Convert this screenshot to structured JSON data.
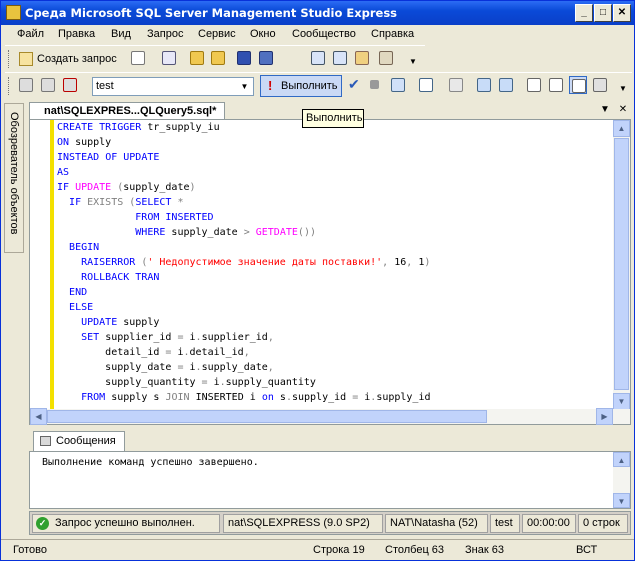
{
  "window": {
    "title": "Среда Microsoft SQL Server Management Studio Express"
  },
  "menu": [
    "Файл",
    "Правка",
    "Вид",
    "Запрос",
    "Сервис",
    "Окно",
    "Сообщество",
    "Справка"
  ],
  "toolbar": {
    "new_query_label": "Создать запрос",
    "database": "test",
    "execute_label": "Выполнить",
    "execute_tooltip": "Выполнить"
  },
  "sidebar": {
    "object_explorer_label": "Обозреватель объектов"
  },
  "document_tab": {
    "title": "nat\\SQLEXPRES...QLQuery5.sql*"
  },
  "code_lines": [
    "CREATE TRIGGER tr_supply_iu",
    "ON supply",
    "INSTEAD OF UPDATE",
    "AS",
    "IF UPDATE (supply_date)",
    "  IF EXISTS (SELECT *",
    "             FROM INSERTED",
    "             WHERE supply_date > GETDATE())",
    "  BEGIN",
    "    RAISERROR (' Недопустимое значение даты поставки!', 16, 1)",
    "    ROLLBACK TRAN",
    "  END",
    "  ELSE",
    "    UPDATE supply",
    "    SET supplier_id = i.supplier_id,",
    "        detail_id = i.detail_id,",
    "        supply_date = i.supply_date,",
    "        supply_quantity = i.supply_quantity",
    "    FROM supply s JOIN INSERTED i on s.supply_id = i.supply_id"
  ],
  "results": {
    "tab_label": "Сообщения",
    "message": "Выполнение команд успешно завершено."
  },
  "query_status": {
    "status_text": "Запрос успешно выполнен.",
    "server": "nat\\SQLEXPRESS (9.0 SP2)",
    "login": "NAT\\Natasha (52)",
    "database": "test",
    "elapsed": "00:00:00",
    "rows": "0 строк"
  },
  "statusbar": {
    "ready": "Готово",
    "line": "Строка 19",
    "column": "Столбец 63",
    "char": "Знак 63",
    "mode": "ВСТ"
  }
}
